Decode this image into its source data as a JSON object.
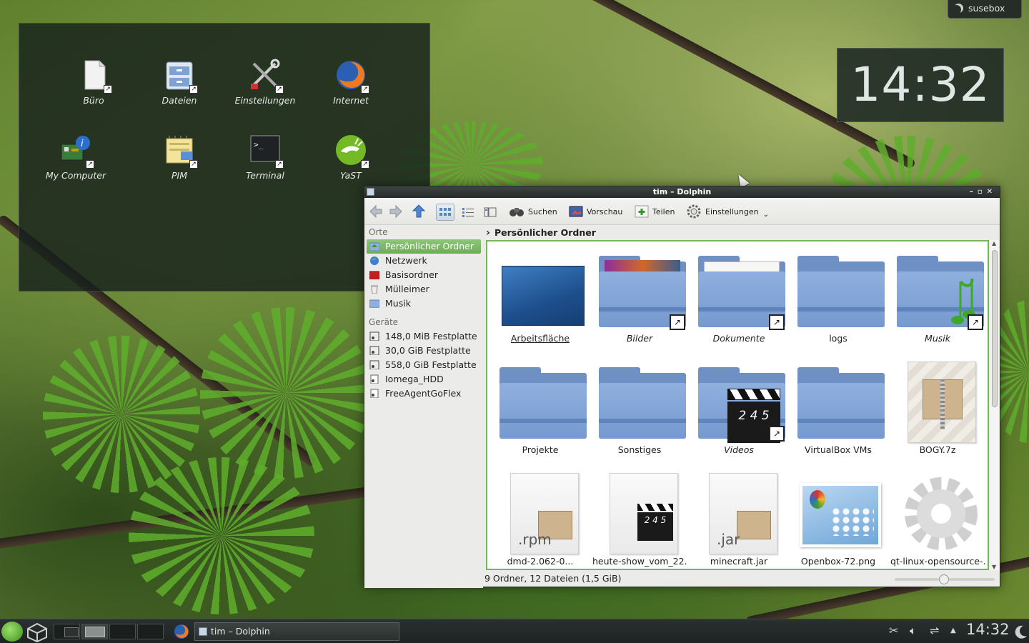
{
  "desktop": {
    "user_tag": "susebox",
    "clock": "14:32",
    "folderview_items": [
      {
        "label": "Büro",
        "icon": "document-icon"
      },
      {
        "label": "Dateien",
        "icon": "file-cabinet-icon"
      },
      {
        "label": "Einstellungen",
        "icon": "tools-icon"
      },
      {
        "label": "Internet",
        "icon": "firefox-icon"
      },
      {
        "label": "My Computer",
        "icon": "computer-icon"
      },
      {
        "label": "PIM",
        "icon": "pim-icon"
      },
      {
        "label": "Terminal",
        "icon": "terminal-icon"
      },
      {
        "label": "YaST",
        "icon": "yast-icon"
      }
    ]
  },
  "dolphin": {
    "title": "tim – Dolphin",
    "toolbar": {
      "search": "Suchen",
      "preview": "Vorschau",
      "share": "Teilen",
      "settings": "Einstellungen"
    },
    "sidebar": {
      "places_title": "Orte",
      "places": [
        "Persönlicher Ordner",
        "Netzwerk",
        "Basisordner",
        "Mülleimer",
        "Musik"
      ],
      "devices_title": "Geräte",
      "devices": [
        "148,0 MiB Festplatte",
        "30,0 GiB Festplatte",
        "558,0 GiB Festplatte",
        "Iomega_HDD",
        "FreeAgentGoFlex"
      ]
    },
    "breadcrumb": "Persönlicher Ordner",
    "items": [
      {
        "label": "Arbeitsfläche"
      },
      {
        "label": "Bilder"
      },
      {
        "label": "Dokumente"
      },
      {
        "label": "logs"
      },
      {
        "label": "Musik"
      },
      {
        "label": "Projekte"
      },
      {
        "label": "Sonstiges"
      },
      {
        "label": "Videos"
      },
      {
        "label": "VirtualBox VMs"
      },
      {
        "label": "BOGY.7z"
      },
      {
        "label": "dmd-2.062-0..."
      },
      {
        "label": "heute-show_vom_22..."
      },
      {
        "label": "minecraft.jar"
      },
      {
        "label": "Openbox-72.png"
      },
      {
        "label": "qt-linux-opensource-..."
      }
    ],
    "file_badges": {
      "rpm": ".rpm",
      "jar": ".jar",
      "clap": "2 4 5"
    },
    "status": "9 Ordner, 12 Dateien (1,5 GiB)"
  },
  "taskbar": {
    "task_label": "tim – Dolphin",
    "clock": "14:32"
  }
}
